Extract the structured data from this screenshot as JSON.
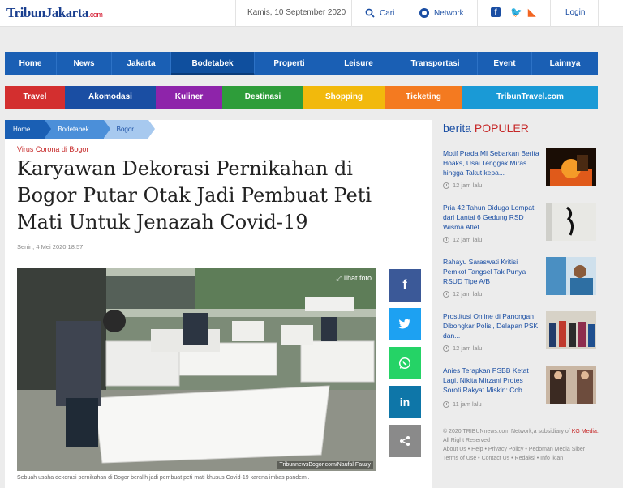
{
  "header": {
    "logo_main": "TribunJakarta",
    "logo_domain": ".com",
    "date": "Kamis, 10 September 2020",
    "search_label": "Cari",
    "network_label": "Network",
    "login_label": "Login"
  },
  "nav": {
    "items": [
      "Home",
      "News",
      "Jakarta",
      "Bodetabek",
      "Properti",
      "Leisure",
      "Transportasi",
      "Event",
      "Lainnya"
    ]
  },
  "categories": {
    "items": [
      "Travel",
      "Akomodasi",
      "Kuliner",
      "Destinasi",
      "Shopping",
      "Ticketing",
      "TribunTravel.com"
    ],
    "colors": [
      "#d32f2f",
      "#1a4ea3",
      "#8e24aa",
      "#2e9d3a",
      "#f2b90c",
      "#f47a20",
      "#1a9ad6"
    ]
  },
  "breadcrumb": {
    "home": "Home",
    "section": "Bodetabek",
    "sub": "Bogor"
  },
  "article": {
    "section_label": "Virus Corona di Bogor",
    "title": "Karyawan Dekorasi Pernikahan di Bogor Putar Otak Jadi Pembuat Peti Mati Untuk Jenazah Covid-19",
    "date": "Senin, 4 Mei 2020 18:57",
    "photo_button": "lihat foto",
    "photo_credit": "TribunnewsBogor.com/Naufal Fauzy",
    "caption": "Sebuah usaha dekorasi pernikahan di Bogor beralih jadi pembuat peti mati khusus Covid-19 karena imbas pandemi."
  },
  "share": {
    "icons": [
      "facebook-icon",
      "twitter-icon",
      "whatsapp-icon",
      "linkedin-icon",
      "share-icon"
    ],
    "glyphs": [
      "f",
      "🐦",
      "✆",
      "in",
      "⌥"
    ],
    "colors": [
      "#3b5998",
      "#1da1f2",
      "#25d366",
      "#0e76a8",
      "#8a8a8a"
    ]
  },
  "sidebar": {
    "title_prefix": "berita",
    "title_highlight": "POPULER",
    "items": [
      {
        "text": "Motif Prada MI Sebarkan Berita Hoaks, Usai Tenggak Miras hingga Takut kepa...",
        "time": "12 jam lalu"
      },
      {
        "text": "Pria 42 Tahun Diduga Lompat dari Lantai 6 Gedung RSD Wisma Atlet...",
        "time": "12 jam lalu"
      },
      {
        "text": "Rahayu Saraswati Kritisi Pemkot Tangsel Tak Punya RSUD Tipe A/B",
        "time": "12 jam lalu"
      },
      {
        "text": "Prostitusi Online di Panongan Dibongkar Polisi, Delapan PSK dan...",
        "time": "12 jam lalu"
      },
      {
        "text": "Anies Terapkan PSBB Ketat Lagi, Nikita Mirzani Protes Soroti Rakyat Miskin: Cob...",
        "time": "11 jam lalu"
      }
    ]
  },
  "footer": {
    "copyright": "© 2020 TRIBUNnews.com Network,a subsidiary of",
    "kg": "KG Media.",
    "rights": "All Right Reserved",
    "links1": "About Us  •  Help  •  Privacy Policy  •  Pedoman Media Siber",
    "links2": "Terms of Use  •  Contact Us  •  Redaksi  •  Info iklan"
  }
}
